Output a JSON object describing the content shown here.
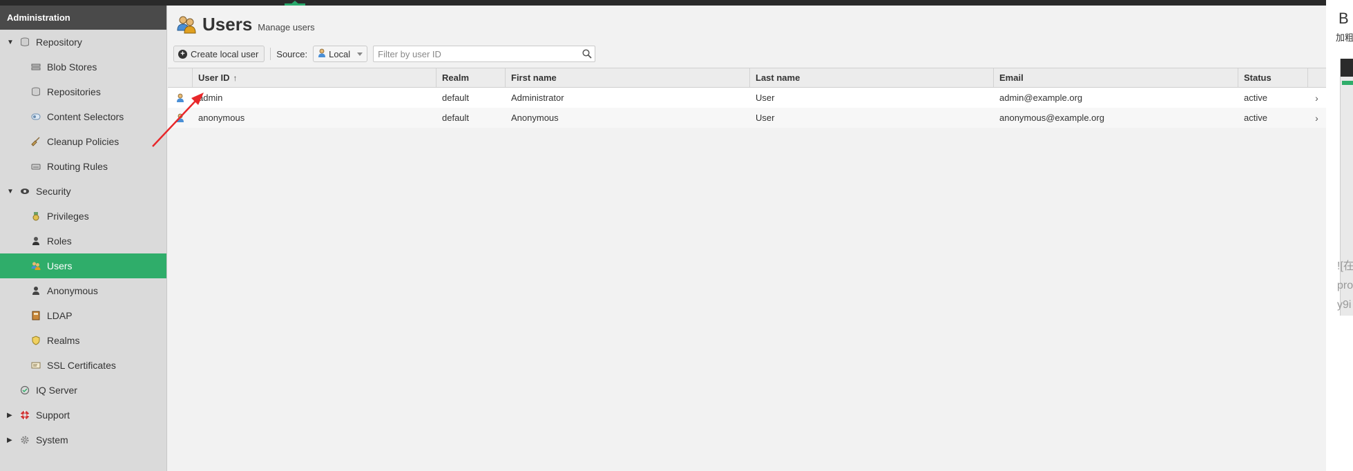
{
  "sidebar": {
    "header": "Administration",
    "items": [
      {
        "label": "Repository",
        "level": 0,
        "caret": "down",
        "icon": "database-icon"
      },
      {
        "label": "Blob Stores",
        "level": 1,
        "icon": "blob-store-icon"
      },
      {
        "label": "Repositories",
        "level": 1,
        "icon": "database-icon"
      },
      {
        "label": "Content Selectors",
        "level": 1,
        "icon": "content-selector-icon"
      },
      {
        "label": "Cleanup Policies",
        "level": 1,
        "icon": "broom-icon"
      },
      {
        "label": "Routing Rules",
        "level": 1,
        "icon": "routing-icon"
      },
      {
        "label": "Security",
        "level": 0,
        "caret": "down",
        "icon": "eye-icon"
      },
      {
        "label": "Privileges",
        "level": 1,
        "icon": "medal-icon"
      },
      {
        "label": "Roles",
        "level": 1,
        "icon": "role-icon"
      },
      {
        "label": "Users",
        "level": 1,
        "icon": "users-icon",
        "active": true
      },
      {
        "label": "Anonymous",
        "level": 1,
        "icon": "anonymous-user-icon"
      },
      {
        "label": "LDAP",
        "level": 1,
        "icon": "book-icon"
      },
      {
        "label": "Realms",
        "level": 1,
        "icon": "shield-icon"
      },
      {
        "label": "SSL Certificates",
        "level": 1,
        "icon": "certificate-icon"
      },
      {
        "label": "IQ Server",
        "level": 0,
        "caret": "none",
        "icon": "iq-server-icon"
      },
      {
        "label": "Support",
        "level": 0,
        "caret": "right",
        "icon": "lifebuoy-icon"
      },
      {
        "label": "System",
        "level": 0,
        "caret": "right",
        "icon": "gear-icon"
      }
    ]
  },
  "page": {
    "title": "Users",
    "subtitle": "Manage users"
  },
  "toolbar": {
    "create_label": "Create local user",
    "source_label": "Source:",
    "source_value": "Local",
    "filter_placeholder": "Filter by user ID"
  },
  "table": {
    "columns": [
      "User ID",
      "Realm",
      "First name",
      "Last name",
      "Email",
      "Status"
    ],
    "sort_indicator": "↑",
    "rows": [
      {
        "user_id": "admin",
        "realm": "default",
        "first_name": "Administrator",
        "last_name": "User",
        "email": "admin@example.org",
        "status": "active"
      },
      {
        "user_id": "anonymous",
        "realm": "default",
        "first_name": "Anonymous",
        "last_name": "User",
        "email": "anonymous@example.org",
        "status": "active"
      }
    ]
  },
  "right_strip": {
    "text1": "B",
    "text2": "加粗",
    "lines": [
      "![在",
      "pro",
      "y9i"
    ]
  },
  "colors": {
    "accent": "#2fad6a",
    "sidebar_bg": "#dadada",
    "header_bg": "#4a4a4a",
    "annotation": "#e8272a"
  }
}
